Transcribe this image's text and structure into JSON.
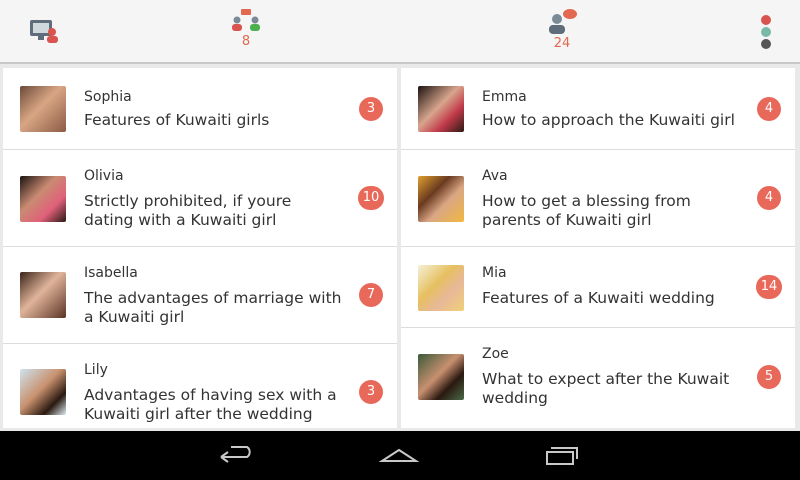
{
  "topbar": {
    "items": [
      {
        "icon": "chat-room-icon",
        "count": ""
      },
      {
        "icon": "group-chat-icon",
        "count": "8"
      },
      {
        "icon": "user-messages-icon",
        "count": "24"
      },
      {
        "icon": "more-dots-icon",
        "count": ""
      }
    ]
  },
  "colors": {
    "badge": "#e8685a",
    "accent": "#e2694f"
  },
  "list": {
    "left": [
      {
        "name": "Sophia",
        "title": "Features of Kuwaiti girls",
        "count": "3"
      },
      {
        "name": "Olivia",
        "title": "Strictly prohibited, if youre dating with a Kuwaiti girl",
        "count": "10"
      },
      {
        "name": "Isabella",
        "title": "The advantages of marriage with a Kuwaiti girl",
        "count": "7"
      },
      {
        "name": "Lily",
        "title": "Advantages of having sex with a Kuwaiti girl after the wedding",
        "count": "3"
      }
    ],
    "right": [
      {
        "name": "Emma",
        "title": "How to approach the Kuwaiti girl",
        "count": "4"
      },
      {
        "name": "Ava",
        "title": "How to get a blessing from parents of Kuwaiti girl",
        "count": "4"
      },
      {
        "name": "Mia",
        "title": "Features of a Kuwaiti wedding",
        "count": "14"
      },
      {
        "name": "Zoe",
        "title": "What to expect after the Kuwait wedding",
        "count": "5"
      }
    ]
  },
  "navbar": {
    "buttons": [
      "back-icon",
      "home-icon",
      "recent-apps-icon"
    ]
  }
}
